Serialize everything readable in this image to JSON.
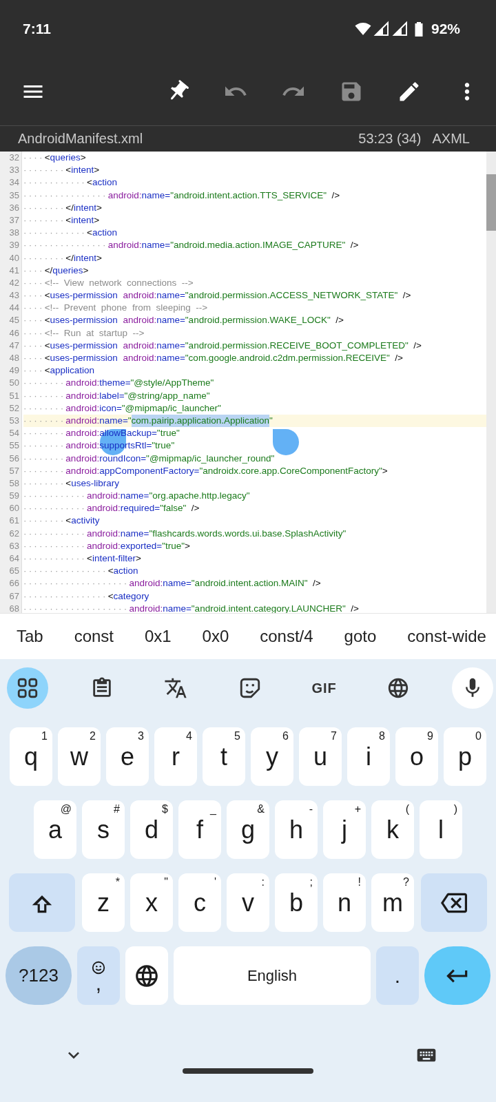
{
  "status_bar": {
    "time": "7:11",
    "battery": "92%"
  },
  "toolbar": {
    "buttons": [
      {
        "kind": "menu",
        "disabled": false
      },
      {
        "kind": "pin",
        "disabled": false
      },
      {
        "kind": "undo",
        "disabled": true
      },
      {
        "kind": "redo",
        "disabled": true
      },
      {
        "kind": "save",
        "disabled": true
      },
      {
        "kind": "edit",
        "disabled": false
      },
      {
        "kind": "more",
        "disabled": false
      }
    ]
  },
  "file_bar": {
    "file_name": "AndroidManifest.xml",
    "cursor": "53:23 (34)",
    "mode": "AXML"
  },
  "editor": {
    "lines": [
      {
        "number": "32",
        "indent": "····",
        "current": false,
        "segments": [
          {
            "kind": "punct",
            "text": "<"
          },
          {
            "kind": "tag",
            "text": "queries"
          },
          {
            "kind": "punct",
            "text": ">"
          }
        ]
      },
      {
        "number": "33",
        "indent": "········",
        "current": false,
        "segments": [
          {
            "kind": "punct",
            "text": "<"
          },
          {
            "kind": "tag",
            "text": "intent"
          },
          {
            "kind": "punct",
            "text": ">"
          }
        ]
      },
      {
        "number": "34",
        "indent": "············",
        "current": false,
        "segments": [
          {
            "kind": "punct",
            "text": "<"
          },
          {
            "kind": "tag",
            "text": "action"
          }
        ]
      },
      {
        "number": "35",
        "indent": "················",
        "current": false,
        "segments": [
          {
            "kind": "ns",
            "text": "android:"
          },
          {
            "kind": "attr",
            "text": "name="
          },
          {
            "kind": "value",
            "text": "\"android.intent.action.TTS_SERVICE\""
          },
          {
            "kind": "punct",
            "text": "  />"
          }
        ]
      },
      {
        "number": "36",
        "indent": "········",
        "current": false,
        "segments": [
          {
            "kind": "punct",
            "text": "</"
          },
          {
            "kind": "tag",
            "text": "intent"
          },
          {
            "kind": "punct",
            "text": ">"
          }
        ]
      },
      {
        "number": "37",
        "indent": "········",
        "current": false,
        "segments": [
          {
            "kind": "punct",
            "text": "<"
          },
          {
            "kind": "tag",
            "text": "intent"
          },
          {
            "kind": "punct",
            "text": ">"
          }
        ]
      },
      {
        "number": "38",
        "indent": "············",
        "current": false,
        "segments": [
          {
            "kind": "punct",
            "text": "<"
          },
          {
            "kind": "tag",
            "text": "action"
          }
        ]
      },
      {
        "number": "39",
        "indent": "················",
        "current": false,
        "segments": [
          {
            "kind": "ns",
            "text": "android:"
          },
          {
            "kind": "attr",
            "text": "name="
          },
          {
            "kind": "value",
            "text": "\"android.media.action.IMAGE_CAPTURE\""
          },
          {
            "kind": "punct",
            "text": "  />"
          }
        ]
      },
      {
        "number": "40",
        "indent": "········",
        "current": false,
        "segments": [
          {
            "kind": "punct",
            "text": "</"
          },
          {
            "kind": "tag",
            "text": "intent"
          },
          {
            "kind": "punct",
            "text": ">"
          }
        ]
      },
      {
        "number": "41",
        "indent": "····",
        "current": false,
        "segments": [
          {
            "kind": "punct",
            "text": "</"
          },
          {
            "kind": "tag",
            "text": "queries"
          },
          {
            "kind": "punct",
            "text": ">"
          }
        ]
      },
      {
        "number": "42",
        "indent": "····",
        "current": false,
        "segments": [
          {
            "kind": "comment",
            "text": "<!--  View  network  connections  -->"
          }
        ]
      },
      {
        "number": "43",
        "indent": "····",
        "current": false,
        "segments": [
          {
            "kind": "punct",
            "text": "<"
          },
          {
            "kind": "tag",
            "text": "uses-permission"
          },
          {
            "kind": "ns",
            "text": "  android:"
          },
          {
            "kind": "attr",
            "text": "name="
          },
          {
            "kind": "value",
            "text": "\"android.permission.ACCESS_NETWORK_STATE\""
          },
          {
            "kind": "punct",
            "text": "  />"
          }
        ]
      },
      {
        "number": "44",
        "indent": "····",
        "current": false,
        "segments": [
          {
            "kind": "comment",
            "text": "<!--  Prevent  phone  from  sleeping  -->"
          }
        ]
      },
      {
        "number": "45",
        "indent": "····",
        "current": false,
        "segments": [
          {
            "kind": "punct",
            "text": "<"
          },
          {
            "kind": "tag",
            "text": "uses-permission"
          },
          {
            "kind": "ns",
            "text": "  android:"
          },
          {
            "kind": "attr",
            "text": "name="
          },
          {
            "kind": "value",
            "text": "\"android.permission.WAKE_LOCK\""
          },
          {
            "kind": "punct",
            "text": "  />"
          }
        ]
      },
      {
        "number": "46",
        "indent": "····",
        "current": false,
        "segments": [
          {
            "kind": "comment",
            "text": "<!--  Run  at  startup  -->"
          }
        ]
      },
      {
        "number": "47",
        "indent": "····",
        "current": false,
        "segments": [
          {
            "kind": "punct",
            "text": "<"
          },
          {
            "kind": "tag",
            "text": "uses-permission"
          },
          {
            "kind": "ns",
            "text": "  android:"
          },
          {
            "kind": "attr",
            "text": "name="
          },
          {
            "kind": "value",
            "text": "\"android.permission.RECEIVE_BOOT_COMPLETED\""
          },
          {
            "kind": "punct",
            "text": "  />"
          }
        ]
      },
      {
        "number": "48",
        "indent": "····",
        "current": false,
        "segments": [
          {
            "kind": "punct",
            "text": "<"
          },
          {
            "kind": "tag",
            "text": "uses-permission"
          },
          {
            "kind": "ns",
            "text": "  android:"
          },
          {
            "kind": "attr",
            "text": "name="
          },
          {
            "kind": "value",
            "text": "\"com.google.android.c2dm.permission.RECEIVE\""
          },
          {
            "kind": "punct",
            "text": "  />"
          }
        ]
      },
      {
        "number": "49",
        "indent": "····",
        "current": false,
        "segments": [
          {
            "kind": "punct",
            "text": "<"
          },
          {
            "kind": "tag",
            "text": "application"
          }
        ]
      },
      {
        "number": "50",
        "indent": "········",
        "current": false,
        "segments": [
          {
            "kind": "ns",
            "text": "android:"
          },
          {
            "kind": "attr",
            "text": "theme="
          },
          {
            "kind": "value",
            "text": "\"@style/AppTheme\""
          }
        ]
      },
      {
        "number": "51",
        "indent": "········",
        "current": false,
        "segments": [
          {
            "kind": "ns",
            "text": "android:"
          },
          {
            "kind": "attr",
            "text": "label="
          },
          {
            "kind": "value",
            "text": "\"@string/app_name\""
          }
        ]
      },
      {
        "number": "52",
        "indent": "········",
        "current": false,
        "segments": [
          {
            "kind": "ns",
            "text": "android:"
          },
          {
            "kind": "attr",
            "text": "icon="
          },
          {
            "kind": "value",
            "text": "\"@mipmap/ic_launcher\""
          }
        ]
      },
      {
        "number": "53",
        "indent": "········",
        "current": true,
        "segments": [
          {
            "kind": "ns",
            "text": "android:"
          },
          {
            "kind": "attr",
            "text": "name="
          },
          {
            "kind": "value",
            "text": "\""
          },
          {
            "kind": "selection",
            "text": "com.pairip.application.Application"
          },
          {
            "kind": "value",
            "text": "\""
          }
        ]
      },
      {
        "number": "54",
        "indent": "········",
        "current": false,
        "segments": [
          {
            "kind": "ns",
            "text": "android:"
          },
          {
            "kind": "attr",
            "text": "allowBackup="
          },
          {
            "kind": "value",
            "text": "\"true\""
          }
        ]
      },
      {
        "number": "55",
        "indent": "········",
        "current": false,
        "segments": [
          {
            "kind": "ns",
            "text": "android:"
          },
          {
            "kind": "attr",
            "text": "supportsRtl="
          },
          {
            "kind": "value",
            "text": "\"true\""
          }
        ]
      },
      {
        "number": "56",
        "indent": "········",
        "current": false,
        "segments": [
          {
            "kind": "ns",
            "text": "android:"
          },
          {
            "kind": "attr",
            "text": "roundIcon="
          },
          {
            "kind": "value",
            "text": "\"@mipmap/ic_launcher_round\""
          }
        ]
      },
      {
        "number": "57",
        "indent": "········",
        "current": false,
        "segments": [
          {
            "kind": "ns",
            "text": "android:"
          },
          {
            "kind": "attr",
            "text": "appComponentFactory="
          },
          {
            "kind": "value",
            "text": "\"androidx.core.app.CoreComponentFactory\""
          },
          {
            "kind": "punct",
            "text": ">"
          }
        ]
      },
      {
        "number": "58",
        "indent": "········",
        "current": false,
        "segments": [
          {
            "kind": "punct",
            "text": "<"
          },
          {
            "kind": "tag",
            "text": "uses-library"
          }
        ]
      },
      {
        "number": "59",
        "indent": "············",
        "current": false,
        "segments": [
          {
            "kind": "ns",
            "text": "android:"
          },
          {
            "kind": "attr",
            "text": "name="
          },
          {
            "kind": "value",
            "text": "\"org.apache.http.legacy\""
          }
        ]
      },
      {
        "number": "60",
        "indent": "············",
        "current": false,
        "segments": [
          {
            "kind": "ns",
            "text": "android:"
          },
          {
            "kind": "attr",
            "text": "required="
          },
          {
            "kind": "value",
            "text": "\"false\""
          },
          {
            "kind": "punct",
            "text": "  />"
          }
        ]
      },
      {
        "number": "61",
        "indent": "········",
        "current": false,
        "segments": [
          {
            "kind": "punct",
            "text": "<"
          },
          {
            "kind": "tag",
            "text": "activity"
          }
        ]
      },
      {
        "number": "62",
        "indent": "············",
        "current": false,
        "segments": [
          {
            "kind": "ns",
            "text": "android:"
          },
          {
            "kind": "attr",
            "text": "name="
          },
          {
            "kind": "value",
            "text": "\"flashcards.words.words.ui.base.SplashActivity\""
          }
        ]
      },
      {
        "number": "63",
        "indent": "············",
        "current": false,
        "segments": [
          {
            "kind": "ns",
            "text": "android:"
          },
          {
            "kind": "attr",
            "text": "exported="
          },
          {
            "kind": "value",
            "text": "\"true\""
          },
          {
            "kind": "punct",
            "text": ">"
          }
        ]
      },
      {
        "number": "64",
        "indent": "············",
        "current": false,
        "segments": [
          {
            "kind": "punct",
            "text": "<"
          },
          {
            "kind": "tag",
            "text": "intent-filter"
          },
          {
            "kind": "punct",
            "text": ">"
          }
        ]
      },
      {
        "number": "65",
        "indent": "················",
        "current": false,
        "segments": [
          {
            "kind": "punct",
            "text": "<"
          },
          {
            "kind": "tag",
            "text": "action"
          }
        ]
      },
      {
        "number": "66",
        "indent": "····················",
        "current": false,
        "segments": [
          {
            "kind": "ns",
            "text": "android:"
          },
          {
            "kind": "attr",
            "text": "name="
          },
          {
            "kind": "value",
            "text": "\"android.intent.action.MAIN\""
          },
          {
            "kind": "punct",
            "text": "  />"
          }
        ]
      },
      {
        "number": "67",
        "indent": "················",
        "current": false,
        "segments": [
          {
            "kind": "punct",
            "text": "<"
          },
          {
            "kind": "tag",
            "text": "category"
          }
        ]
      },
      {
        "number": "68",
        "indent": "····················",
        "current": false,
        "segments": [
          {
            "kind": "ns",
            "text": "android:"
          },
          {
            "kind": "attr",
            "text": "name="
          },
          {
            "kind": "value",
            "text": "\"android.intent.category.LAUNCHER\""
          },
          {
            "kind": "punct",
            "text": "  />"
          }
        ]
      }
    ]
  },
  "suggestions": [
    "Tab",
    "const",
    "0x1",
    "0x0",
    "const/4",
    "goto",
    "const-wide"
  ],
  "keyboard": {
    "toolbar": [
      {
        "kind": "apps",
        "selected": true
      },
      {
        "kind": "clipboard",
        "selected": false
      },
      {
        "kind": "translate",
        "selected": false
      },
      {
        "kind": "sticker",
        "selected": false
      },
      {
        "kind": "gif",
        "label": "GIF",
        "selected": false
      },
      {
        "kind": "language",
        "selected": false
      },
      {
        "kind": "mic",
        "selected": false
      }
    ],
    "rows": [
      {
        "keys": [
          {
            "kind": "letter",
            "label": "q",
            "hint": "1"
          },
          {
            "kind": "letter",
            "label": "w",
            "hint": "2"
          },
          {
            "kind": "letter",
            "label": "e",
            "hint": "3"
          },
          {
            "kind": "letter",
            "label": "r",
            "hint": "4"
          },
          {
            "kind": "letter",
            "label": "t",
            "hint": "5"
          },
          {
            "kind": "letter",
            "label": "y",
            "hint": "6"
          },
          {
            "kind": "letter",
            "label": "u",
            "hint": "7"
          },
          {
            "kind": "letter",
            "label": "i",
            "hint": "8"
          },
          {
            "kind": "letter",
            "label": "o",
            "hint": "9"
          },
          {
            "kind": "letter",
            "label": "p",
            "hint": "0"
          }
        ]
      },
      {
        "keys": [
          {
            "kind": "letter",
            "label": "a",
            "hint": "@"
          },
          {
            "kind": "letter",
            "label": "s",
            "hint": "#"
          },
          {
            "kind": "letter",
            "label": "d",
            "hint": "$"
          },
          {
            "kind": "letter",
            "label": "f",
            "hint": "_"
          },
          {
            "kind": "letter",
            "label": "g",
            "hint": "&"
          },
          {
            "kind": "letter",
            "label": "h",
            "hint": "-"
          },
          {
            "kind": "letter",
            "label": "j",
            "hint": "+"
          },
          {
            "kind": "letter",
            "label": "k",
            "hint": "("
          },
          {
            "kind": "letter",
            "label": "l",
            "hint": ")"
          }
        ]
      },
      {
        "keys": [
          {
            "kind": "shift"
          },
          {
            "kind": "letter",
            "label": "z",
            "hint": "*"
          },
          {
            "kind": "letter",
            "label": "x",
            "hint": "\""
          },
          {
            "kind": "letter",
            "label": "c",
            "hint": "'"
          },
          {
            "kind": "letter",
            "label": "v",
            "hint": ":"
          },
          {
            "kind": "letter",
            "label": "b",
            "hint": ";"
          },
          {
            "kind": "letter",
            "label": "n",
            "hint": "!"
          },
          {
            "kind": "letter",
            "label": "m",
            "hint": "?"
          },
          {
            "kind": "backspace"
          }
        ]
      },
      {
        "keys": [
          {
            "kind": "symbols",
            "label": "?123"
          },
          {
            "kind": "emoji",
            "label": ","
          },
          {
            "kind": "globe"
          },
          {
            "kind": "space",
            "label": "English"
          },
          {
            "kind": "period",
            "label": "."
          },
          {
            "kind": "enter"
          }
        ]
      }
    ]
  }
}
